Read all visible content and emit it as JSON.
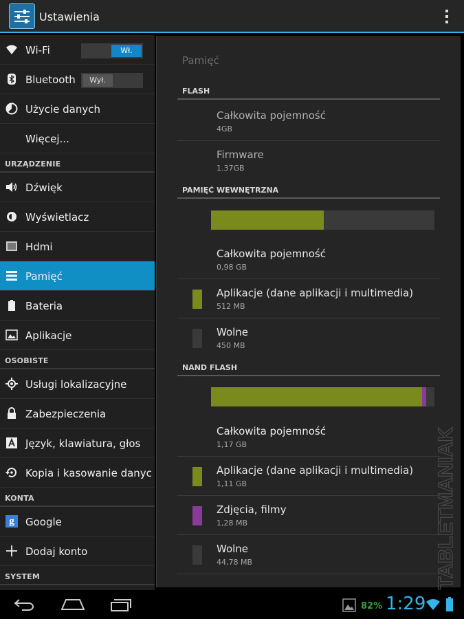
{
  "action_bar": {
    "title": "Ustawienia",
    "icon": "settings-sliders-icon",
    "menu_icon": "overflow-menu-icon"
  },
  "sidebar": {
    "items": [
      {
        "label": "Wi-Fi",
        "icon": "wifi-icon",
        "toggle": "Wł.",
        "toggle_state": "on"
      },
      {
        "label": "Bluetooth",
        "icon": "bluetooth-icon",
        "toggle": "Wył.",
        "toggle_state": "off"
      },
      {
        "label": "Użycie danych",
        "icon": "data-usage-icon"
      },
      {
        "label": "Więcej...",
        "icon": ""
      }
    ],
    "section_device": "URZĄDZENIE",
    "device_items": [
      {
        "label": "Dźwięk",
        "icon": "speaker-icon"
      },
      {
        "label": "Wyświetlacz",
        "icon": "brightness-icon"
      },
      {
        "label": "Hdmi",
        "icon": "hdmi-icon"
      },
      {
        "label": "Pamięć",
        "icon": "storage-icon",
        "active": true
      },
      {
        "label": "Bateria",
        "icon": "battery-icon"
      },
      {
        "label": "Aplikacje",
        "icon": "apps-icon"
      }
    ],
    "section_personal": "OSOBISTE",
    "personal_items": [
      {
        "label": "Usługi lokalizacyjne",
        "icon": "location-icon"
      },
      {
        "label": "Zabezpieczenia",
        "icon": "lock-icon"
      },
      {
        "label": "Język, klawiatura, głos",
        "icon": "language-icon"
      },
      {
        "label": "Kopia i kasowanie danyc",
        "icon": "backup-icon"
      }
    ],
    "section_accounts": "KONTA",
    "account_items": [
      {
        "label": "Google",
        "icon": "google-icon",
        "glyph": "g"
      },
      {
        "label": "Dodaj konto",
        "icon": "add-icon"
      }
    ],
    "section_system": "SYSTEM"
  },
  "detail": {
    "title": "Pamięć",
    "flash": {
      "header": "FLASH",
      "rows": [
        {
          "title": "Całkowita pojemność",
          "value": "4GB"
        },
        {
          "title": "Firmware",
          "value": "1.37GB"
        }
      ]
    },
    "internal": {
      "header": "PAMIĘĆ WEWNĘTRZNA",
      "bar": {
        "apps_fraction": 0.505
      },
      "rows": [
        {
          "title": "Całkowita pojemność",
          "value": "0,98 GB"
        },
        {
          "title": "Aplikacje (dane aplikacji i multimedia)",
          "value": "512 MB",
          "swatch": "#7a8a1c"
        },
        {
          "title": "Wolne",
          "value": "450 MB",
          "swatch": "#3a3a3a"
        }
      ]
    },
    "nand": {
      "header": "NAND FLASH",
      "bar": {
        "apps_fraction": 0.945,
        "media_fraction": 0.017
      },
      "rows": [
        {
          "title": "Całkowita pojemność",
          "value": "1,17 GB"
        },
        {
          "title": "Aplikacje (dane aplikacji i multimedia)",
          "value": "1,11 GB",
          "swatch": "#7a8a1c"
        },
        {
          "title": "Zdjęcia, filmy",
          "value": "1,28 MB",
          "swatch": "#8a3a9a"
        },
        {
          "title": "Wolne",
          "value": "44,78 MB",
          "swatch": "#3a3a3a"
        }
      ]
    },
    "colors": {
      "apps": "#7a8a1c",
      "media": "#8a3a9a",
      "free": "#3a3a3a",
      "accent": "#33b5e5"
    }
  },
  "watermark": "TABLETMANIAK",
  "status_bar": {
    "battery_percent": "82%",
    "time": "1:29",
    "icons": [
      "gallery-notification-icon",
      "wifi-signal-icon",
      "battery-icon"
    ],
    "nav_icons": [
      "back-icon",
      "home-icon",
      "recent-apps-icon"
    ]
  }
}
